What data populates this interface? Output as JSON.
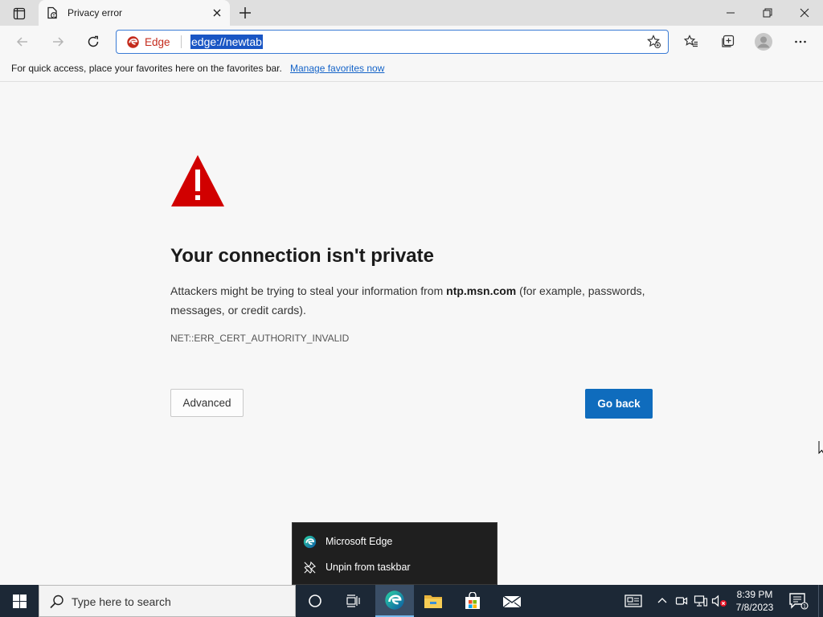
{
  "browser": {
    "tab": {
      "title": "Privacy error"
    },
    "address": {
      "badge_label": "Edge",
      "url": "edge://newtab"
    },
    "favorites_bar": {
      "message": "For quick access, place your favorites here on the favorites bar.",
      "link": "Manage favorites now"
    }
  },
  "error_page": {
    "heading": "Your connection isn't private",
    "body_prefix": "Attackers might be trying to steal your information from ",
    "body_host": "ntp.msn.com",
    "body_suffix": " (for example, passwords, messages, or credit cards).",
    "error_code": "NET::ERR_CERT_AUTHORITY_INVALID",
    "advanced_button": "Advanced",
    "go_back_button": "Go back"
  },
  "jump_list": {
    "items": [
      {
        "label": "Microsoft Edge",
        "icon": "edge-logo-icon"
      },
      {
        "label": "Unpin from taskbar",
        "icon": "unpin-icon"
      }
    ]
  },
  "taskbar": {
    "search_placeholder": "Type here to search",
    "clock": {
      "time": "8:39 PM",
      "date": "7/8/2023"
    }
  },
  "colors": {
    "accent": "#0f6cbd",
    "warning_red": "#d10000",
    "taskbar_bg": "#1c2836"
  }
}
